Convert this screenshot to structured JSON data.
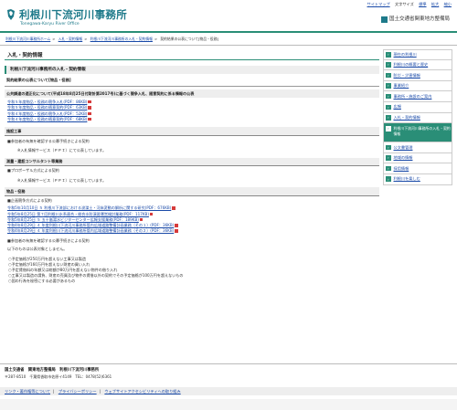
{
  "header": {
    "title": "利根川下流河川事務所",
    "subtitle": "Tonegawa-Karyu River Office",
    "util_links": [
      "サイトマップ",
      "文字サイズ",
      "標準",
      "拡大",
      "縮小"
    ],
    "ministry": "国土交通省関東地方整備局"
  },
  "breadcrumb": [
    "利根川下流河川事務所ホーム",
    "入札・契約情報",
    "利根川下流河川事務所の入札・契約情報",
    "契約結果の公表について[物品・役務]"
  ],
  "main": {
    "page_title": "入札・契約情報",
    "section_title": "利根川下流河川事務所の入札・契約情報",
    "page_subtitle": "契約結果の公表について[物品・役務]",
    "public_notice_heading": "公共調達の適正化について(平成18年8月25日付財計第2017号)に基づく競争入札、随意契約に係る情報の公表",
    "public_notice_docs": [
      "令和５年度物品・役務の競争入札(PDF：86KB)",
      "令和５年度物品・役務の随意契約(PDF：63KB)",
      "令和４年度物品・役務の競争入札(PDF：52KB)",
      "令和４年度物品・役務の随意契約(PDF：68KB)"
    ],
    "construction": {
      "heading": "施設工事",
      "item": "■参加者の有無を確認する公募手続きによる契約",
      "note": "※入札情報サービス（ＰＰＩ）にて公表しています。"
    },
    "consulting": {
      "heading": "測量・建設コンサルタント等業務",
      "item": "■プロポーザル方式による契約",
      "note": "※入札情報サービス（ＰＰＩ）にて公表しています。"
    },
    "goods": {
      "heading": "物品・役務",
      "item": "■企画競争方式による契約",
      "docs": [
        "令和5年10月10日 ５ 利根川下流部における浚渫土・河床変動の解析に関する研究(PDF：676KB)",
        "令和5年8月25日 第７回利根川水系連合・総合水防演習運営検討業務(PDF：117KB)",
        "令和5年8月25日 ５ 五十嵐湯水ビジターセンター広報支援業務(PDF：189KB)",
        "令和4年8月29日 ４ 年度利根川下流河川事務所管内広域道路整備計画業務（その１）(PDF：36KB)",
        "令和4年8月29日 ４ 年度利根川下流河川事務所管内広域道路整備計画業務（その２）(PDF：36KB)"
      ],
      "item2": "■参加者の有無を確認する公募手続きによる契約",
      "none_text": "以下のものは公表対象としません。",
      "conditions": [
        "○予定価格が250万円を超えない工事又は製造",
        "○予定価格が160万円を超えない財産の買い入れ",
        "○予定賃借料の年額又は総額が80万円を超えない物件の借り入れ",
        "○工事又は製造の請負、財産の売買及び物件の賃借以外の契約でその予定価格が100万円を超えないもの",
        "○国の行為を秘密にする必要があるもの"
      ]
    }
  },
  "sidebar": {
    "items": [
      "現在の利根川",
      "利根川の概要と歴史",
      "防災・災害情報",
      "事業紹介",
      "事務所・施設のご案内",
      "広報",
      "入札・契約情報",
      "利根川下流河川事務所の入札・契約情報",
      "公文書管理",
      "地域の情報",
      "採用情報",
      "利根川を楽しむ"
    ]
  },
  "footer": {
    "org": "国土交通省　関東地方整備局　利根川下流河川事務所",
    "address": "〒287-8510　千葉県香取市佐原イ4149　TEL：0478(52)6361",
    "links": [
      "リンク・著作権等について",
      "プライバシーポリシー",
      "ウェブサイトアクセシビリティへの取り組み"
    ]
  },
  "colors": {
    "brand": "#2a8e77",
    "title": "#1e7a8a",
    "link": "#1a4aa8",
    "pdf": "#d63b3b"
  }
}
